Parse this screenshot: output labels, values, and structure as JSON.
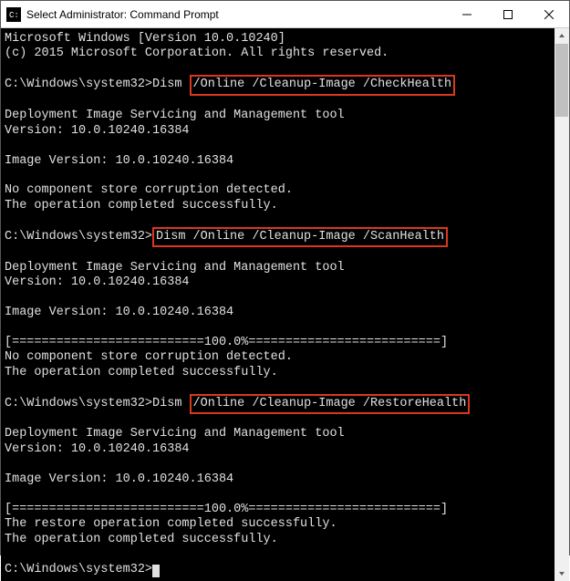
{
  "window": {
    "title": "Select Administrator: Command Prompt"
  },
  "terminal": {
    "line1": "Microsoft Windows [Version 10.0.10240]",
    "line2": "(c) 2015 Microsoft Corporation. All rights reserved.",
    "blank": " ",
    "prompt1_pre": "C:\\Windows\\system32>Dism ",
    "highlight1": "/Online /Cleanup-Image /CheckHealth",
    "tool_line": "Deployment Image Servicing and Management tool",
    "version_line": "Version: 10.0.10240.16384",
    "image_version": "Image Version: 10.0.10240.16384",
    "no_corruption": "No component store corruption detected.",
    "op_success": "The operation completed successfully.",
    "prompt2_pre": "C:\\Windows\\system32>",
    "highlight2": "Dism /Online /Cleanup-Image /ScanHealth",
    "progress": "[==========================100.0%==========================]",
    "prompt3_pre": "C:\\Windows\\system32>Dism ",
    "highlight3": "/Online /Cleanup-Image /RestoreHealth",
    "restore_success": "The restore operation completed successfully.",
    "final_prompt": "C:\\Windows\\system32>"
  }
}
